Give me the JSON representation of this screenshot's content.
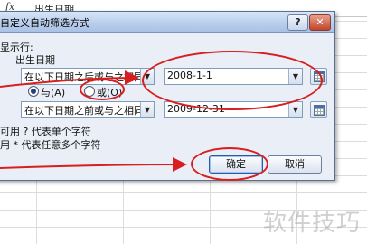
{
  "formula_bar": {
    "fx_glyph": "fx",
    "cell_text": "出生日期"
  },
  "dialog": {
    "title": "自定义自动筛选方式",
    "help_glyph": "?",
    "close_glyph": "✕",
    "show_rows_label": "显示行:",
    "field_label": "出生日期",
    "condition1": {
      "operator": "在以下日期之后或与之相同",
      "value": "2008-1-1"
    },
    "logic": {
      "and_label": "与(A)",
      "or_label": "或(O)",
      "selected": "and"
    },
    "condition2": {
      "operator": "在以下日期之前或与之相同",
      "value": "2009-12-31"
    },
    "hint1": "可用 ? 代表单个字符",
    "hint2": "用 * 代表任意多个字符",
    "ok_label": "确定",
    "cancel_label": "取消"
  },
  "icons": {
    "dropdown": "chevron-down-icon",
    "picker": "table-picker-icon"
  },
  "annotation_color": "#d81e1e",
  "watermark": "软件技巧"
}
